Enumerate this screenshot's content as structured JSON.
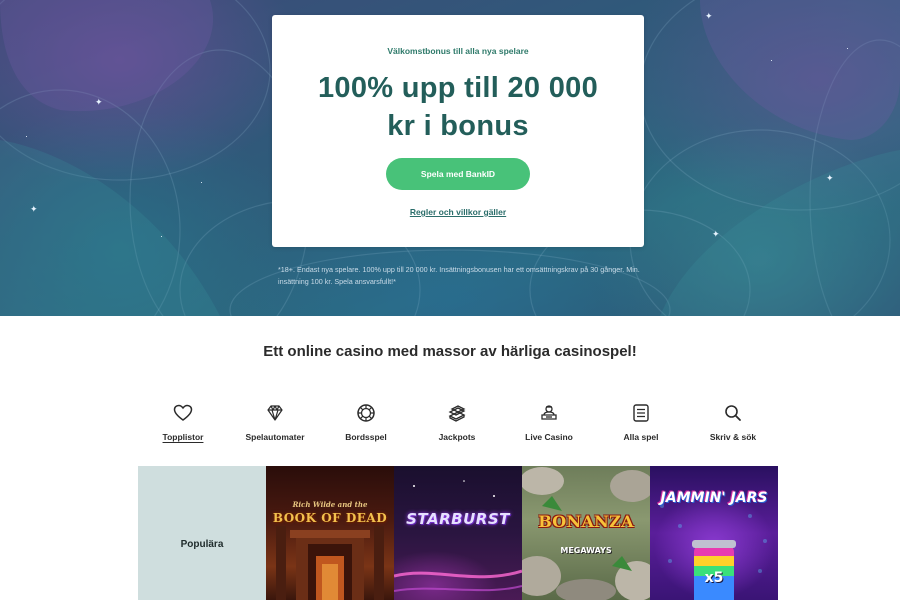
{
  "hero": {
    "eyebrow": "Välkomstbonus till alla nya spelare",
    "title_line1": "100% upp till 20 000",
    "title_line2": "kr i bonus",
    "cta_label": "Spela med BankID",
    "terms_label": "Regler och villkor gäller",
    "disclaimer": "*18+. Endast nya spelare. 100% upp till 20 000 kr. Insättningsbonusen har ett omsättningskrav på 30 gånger. Min. insättning 100 kr. Spela ansvarsfullt!*"
  },
  "headline": "Ett online casino med massor av härliga casinospel!",
  "categories": [
    {
      "label": "Topplistor",
      "icon": "heart-icon",
      "active": true
    },
    {
      "label": "Spelautomater",
      "icon": "diamond-icon"
    },
    {
      "label": "Bordsspel",
      "icon": "chip-icon"
    },
    {
      "label": "Jackpots",
      "icon": "coin-stack-icon"
    },
    {
      "label": "Live Casino",
      "icon": "dealer-icon"
    },
    {
      "label": "Alla spel",
      "icon": "list-icon"
    },
    {
      "label": "Skriv & sök",
      "icon": "search-icon"
    }
  ],
  "games": {
    "section_label": "Populära",
    "tiles": [
      {
        "title_small": "Rich Wilde and the",
        "title": "BOOK OF DEAD"
      },
      {
        "title": "STARBURST"
      },
      {
        "title": "BONANZA",
        "subtitle": "MEGAWAYS"
      },
      {
        "title": "JAMMIN' JARS",
        "badge": "x5"
      }
    ]
  },
  "colors": {
    "brand_green": "#48c279",
    "title_teal": "#235e5a",
    "popular_bg": "#cfdede"
  }
}
